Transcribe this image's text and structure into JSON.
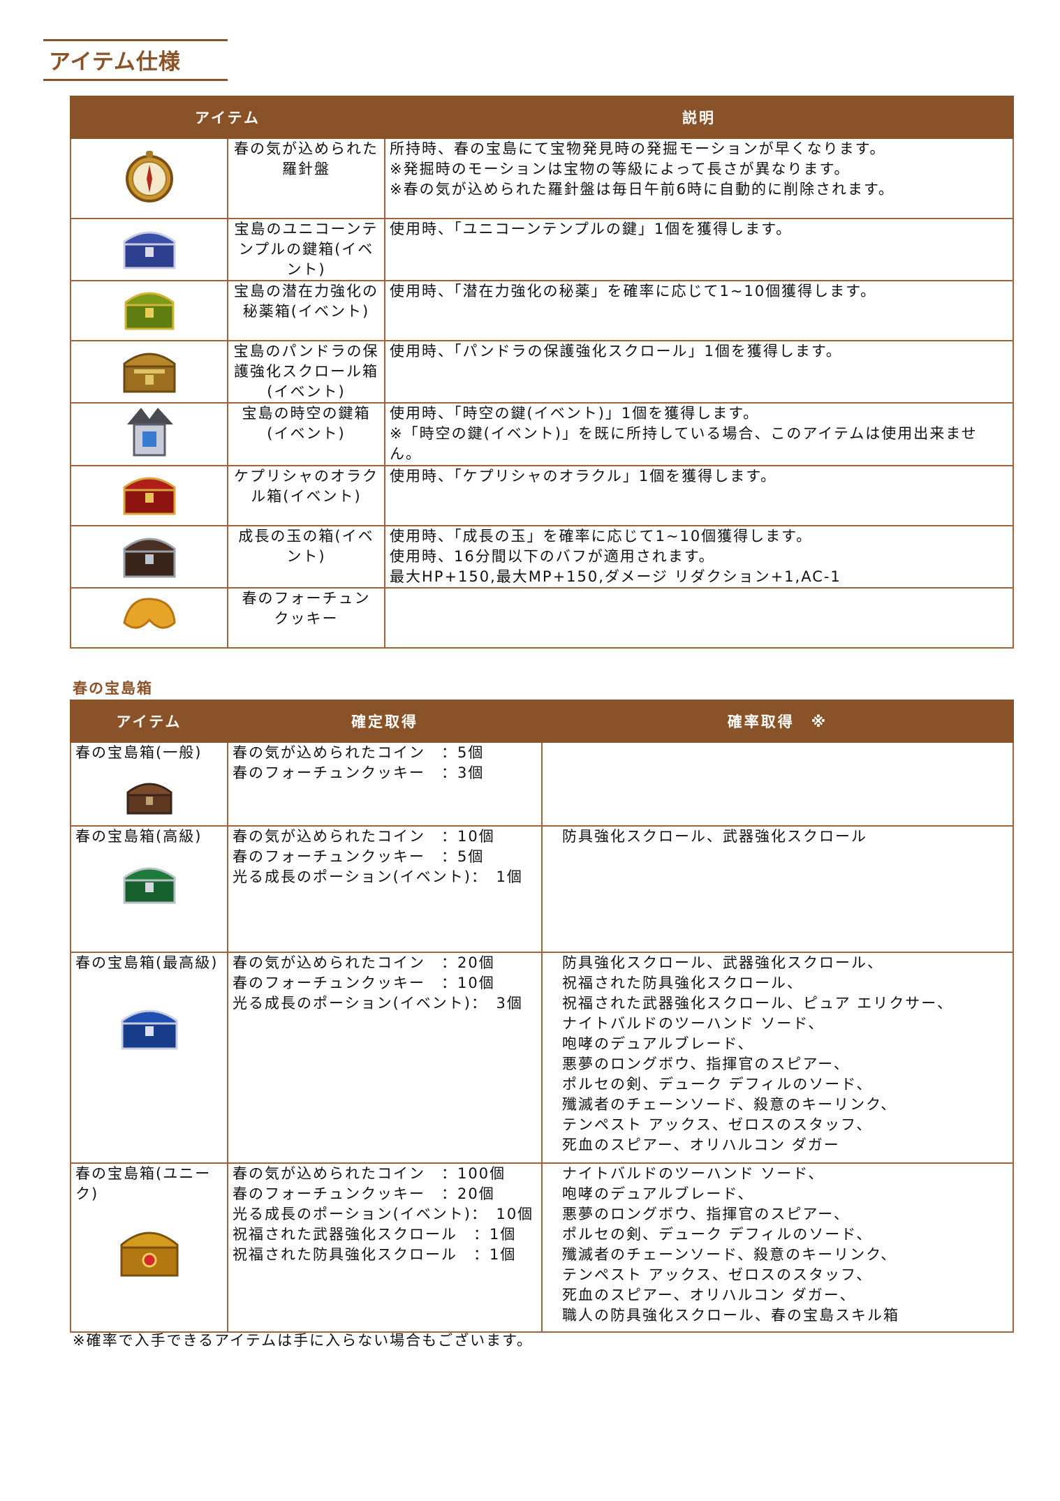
{
  "page_title": "アイテム仕様",
  "items_table": {
    "headers": [
      "アイテム",
      "説明"
    ],
    "rows": [
      {
        "icon": "compass-icon",
        "name": [
          "春の気が込められた",
          "羅針盤"
        ],
        "desc": [
          "所持時、春の宝島にて宝物発見時の発掘モーションが早くなります。",
          "※発掘時のモーションは宝物の等級によって長さが異なります。",
          "※春の気が込められた羅針盤は毎日午前6時に自動的に削除されます。"
        ]
      },
      {
        "icon": "blue-chest-icon",
        "name": [
          "宝島のユニコーンテ",
          "ンプルの鍵箱(イベ",
          "ント)"
        ],
        "desc": [
          "使用時、「ユニコーンテンプルの鍵」1個を獲得します。"
        ]
      },
      {
        "icon": "green-chest-icon",
        "name": [
          "宝島の潜在力強化の",
          "秘薬箱(イベント)"
        ],
        "desc": [
          "使用時、「潜在力強化の秘薬」を確率に応じて1~10個獲得します。"
        ]
      },
      {
        "icon": "gold-chest-icon",
        "name": [
          "宝島のパンドラの保",
          "護強化スクロール箱",
          "(イベント)"
        ],
        "desc": [
          "使用時、「パンドラの保護強化スクロール」1個を獲得します。"
        ]
      },
      {
        "icon": "dragon-key-box-icon",
        "name": [
          "宝島の時空の鍵箱",
          "(イベント)"
        ],
        "desc": [
          "使用時、「時空の鍵(イベント)」1個を獲得します。",
          "※「時空の鍵(イベント)」を既に所持している場合、このアイテムは使用出来ませ",
          "ん。"
        ]
      },
      {
        "icon": "red-chest-icon",
        "name": [
          "ケプリシャのオラク",
          "ル箱(イベント)"
        ],
        "desc": [
          "使用時、「ケプリシャのオラクル」1個を獲得します。"
        ]
      },
      {
        "icon": "dark-chest-icon",
        "name": [
          "成長の玉の箱(イベ",
          "ント)"
        ],
        "desc": [
          "使用時、「成長の玉」を確率に応じて1~10個獲得します。",
          "使用時、16分間以下のバフが適用されます。",
          "最大HP+150,最大MP+150,ダメージ リダクション+1,AC-1"
        ]
      },
      {
        "icon": "fortune-cookie-icon",
        "name": [
          "春のフォーチュン",
          "クッキー"
        ],
        "desc": []
      }
    ]
  },
  "box_section_label": "春の宝島箱",
  "box_table": {
    "headers": [
      "アイテム",
      "確定取得",
      "確率取得　※"
    ],
    "rows": [
      {
        "name": [
          "春の宝島箱(一般)"
        ],
        "icon": "brown-chest-icon",
        "fixed": [
          "春の気が込められたコイン　：5個",
          "春のフォーチュンクッキー　：3個"
        ],
        "prob": []
      },
      {
        "name": [
          "春の宝島箱(高級)"
        ],
        "icon": "green-chest-icon",
        "fixed": [
          "春の気が込められたコイン　：10個",
          "春のフォーチュンクッキー　：5個",
          "光る成長のポーション(イベント)：　1個"
        ],
        "prob": [
          "防具強化スクロール、武器強化スクロール"
        ]
      },
      {
        "name": [
          "春の宝島箱(最高級)"
        ],
        "icon": "blue-chest-icon",
        "fixed": [
          "春の気が込められたコイン　：20個",
          "春のフォーチュンクッキー　：10個",
          "光る成長のポーション(イベント)：　3個"
        ],
        "prob": [
          "防具強化スクロール、武器強化スクロール、",
          "祝福された防具強化スクロール、",
          "祝福された武器強化スクロール、ピュア エリクサー、",
          "ナイトバルドのツーハンド ソード、",
          "咆哮のデュアルブレード、",
          "悪夢のロングボウ、指揮官のスピアー、",
          "ポルセの剣、デューク デフィルのソード、",
          "殲滅者のチェーンソード、殺意のキーリンク、",
          "テンペスト アックス、ゼロスのスタッフ、",
          "死血のスピアー、オリハルコン ダガー"
        ]
      },
      {
        "name": [
          "春の宝島箱(ユニー",
          "ク)"
        ],
        "icon": "golden-treasure-icon",
        "fixed": [
          "春の気が込められたコイン　：100個",
          "春のフォーチュンクッキー　：20個",
          "光る成長のポーション(イベント)：　10個",
          "祝福された武器強化スクロール　：1個",
          "祝福された防具強化スクロール　：1個"
        ],
        "prob": [
          "ナイトバルドのツーハンド ソード、",
          "咆哮のデュアルブレード、",
          "悪夢のロングボウ、指揮官のスピアー、",
          "ポルセの剣、デューク デフィルのソード、",
          "殲滅者のチェーンソード、殺意のキーリンク、",
          "テンペスト アックス、ゼロスのスタッフ、",
          "死血のスピアー、オリハルコン ダガー、",
          "職人の防具強化スクロール、春の宝島スキル箱"
        ]
      }
    ]
  },
  "footnote": "※確率で入手できるアイテムは手に入らない場合もございます。"
}
